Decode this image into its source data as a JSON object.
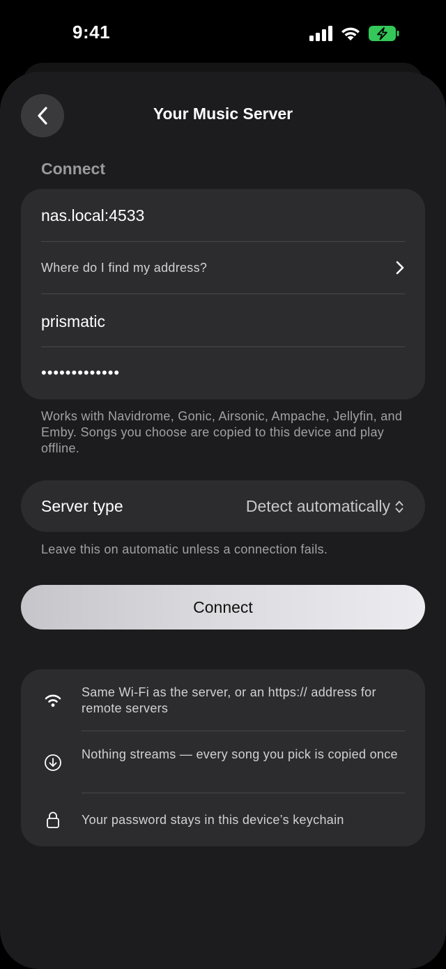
{
  "status_bar": {
    "time": "9:41"
  },
  "nav": {
    "title": "Your Music Server"
  },
  "connect_section": {
    "label": "Connect",
    "address_value": "nas.local:4533",
    "help_link": "Where do I find my address?",
    "username_value": "prismatic",
    "password_value": "•••••••••••••"
  },
  "compat_note": "Works with Navidrome, Gonic, Airsonic, Ampache, Jellyfin, and Emby. Songs you choose are copied to this device and play offline.",
  "server_type": {
    "label": "Server type",
    "value": "Detect automatically"
  },
  "server_type_note": "Leave this on automatic unless a connection fails.",
  "connect_button": "Connect",
  "info": [
    {
      "icon": "wifi-icon",
      "text": "Same Wi-Fi as the server, or an https:// address for remote servers"
    },
    {
      "icon": "download-circle-icon",
      "text": "Nothing streams — every song you pick is copied once"
    },
    {
      "icon": "lock-icon",
      "text": "Your password stays in this device’s keychain"
    }
  ],
  "colors": {
    "battery": "#34c759",
    "sheet": "#1c1c1e",
    "card": "#2c2c2e"
  }
}
